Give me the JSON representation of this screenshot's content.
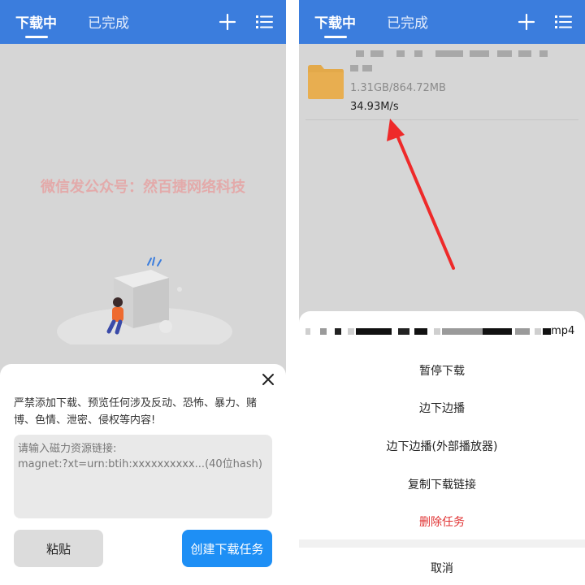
{
  "tabs": {
    "downloading": "下载中",
    "completed": "已完成"
  },
  "left": {
    "watermark": "微信发公众号：然百捷网络科技",
    "warning": "严禁添加下载、预览任何涉及反动、恐怖、暴力、赌博、色情、泄密、侵权等内容!",
    "magnet_placeholder": "请输入磁力资源链接:\nmagnet:?xt=urn:btih:xxxxxxxxxx...(40位hash)",
    "paste_label": "粘贴",
    "create_label": "创建下载任务"
  },
  "right": {
    "task": {
      "size": "1.31GB/864.72MB",
      "speed": "34.93M/s"
    },
    "sheet": {
      "filename_ext": ".mp4",
      "menu": [
        "暂停下载",
        "边下边播",
        "边下边播(外部播放器)",
        "复制下载链接",
        "删除任务"
      ],
      "cancel": "取消"
    }
  },
  "colors": {
    "topbar": "#3b7ddd",
    "primary_button": "#1e8ff5",
    "danger": "#e03131",
    "folder": "#e3a94a",
    "arrow": "#ee2a2a"
  }
}
